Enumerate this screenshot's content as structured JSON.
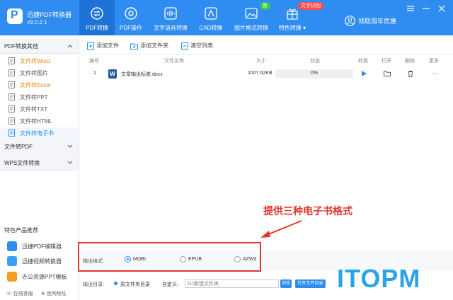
{
  "app": {
    "name": "迅捷PDF转换器",
    "version": "v9.0.2.1",
    "logo_letter": "P"
  },
  "nav": {
    "tabs": [
      {
        "label": "PDF转换",
        "icon": "swap-icon",
        "active": true
      },
      {
        "label": "PDF操作",
        "icon": "compass-icon"
      },
      {
        "label": "文字语音转换",
        "icon": "waveform-icon"
      },
      {
        "label": "CAD转换",
        "icon": "cad-icon"
      },
      {
        "label": "图片格式转换",
        "icon": "image-icon",
        "badge": "新"
      },
      {
        "label": "特色转换",
        "icon": "gift-icon",
        "badge": "文字识别",
        "dropdown": true
      }
    ],
    "user_label": "领取周年优惠"
  },
  "sidebar": {
    "section1": "PDF转换其他",
    "items": [
      {
        "label": "文件转Word",
        "style": "orange"
      },
      {
        "label": "文件转图片"
      },
      {
        "label": "文件转Excel",
        "style": "orange"
      },
      {
        "label": "文件转PPT"
      },
      {
        "label": "文件转TXT"
      },
      {
        "label": "文件转HTML"
      },
      {
        "label": "文件转电子书",
        "style": "active"
      }
    ],
    "section2": "文件转PDF",
    "section3": "WPS文件转换",
    "promo_title": "特色产品推荐",
    "promos": [
      {
        "label": "迅捷PDF编辑器",
        "color": "#2f8cf0"
      },
      {
        "label": "迅捷视频转换器",
        "color": "#3aa0f5"
      },
      {
        "label": "办公资源PPT模板",
        "color": "#f0a020"
      }
    ],
    "links": [
      "在线客服",
      "官网地址"
    ]
  },
  "toolbar": {
    "add_file": "添加文件",
    "add_folder": "添加文件夹",
    "clear_list": "清空列表"
  },
  "table": {
    "headers": [
      "编号",
      "文件名称",
      "大小",
      "状态",
      "转换",
      "打开",
      "删除",
      "更多"
    ],
    "rows": [
      {
        "num": "1",
        "name": "文章输出标准.docx",
        "size": "1007.62KB",
        "progress": "0%"
      }
    ]
  },
  "annotation": "提供三种电子书格式",
  "format": {
    "label": "输出格式:",
    "options": [
      "MOBI",
      "EPUB",
      "AZW3"
    ],
    "selected": "MOBI"
  },
  "output": {
    "label": "输出目录:",
    "source_option": "原文件夹目录",
    "custom_label": "自定义:",
    "path_placeholder": "D:\\新建文件夹",
    "browse": "浏览",
    "open_dir": "打开文件目录"
  },
  "watermark": "ITOPM",
  "colors": {
    "primary": "#2f8cf0",
    "accent_red": "#e0372f",
    "orange": "#e98a15"
  }
}
